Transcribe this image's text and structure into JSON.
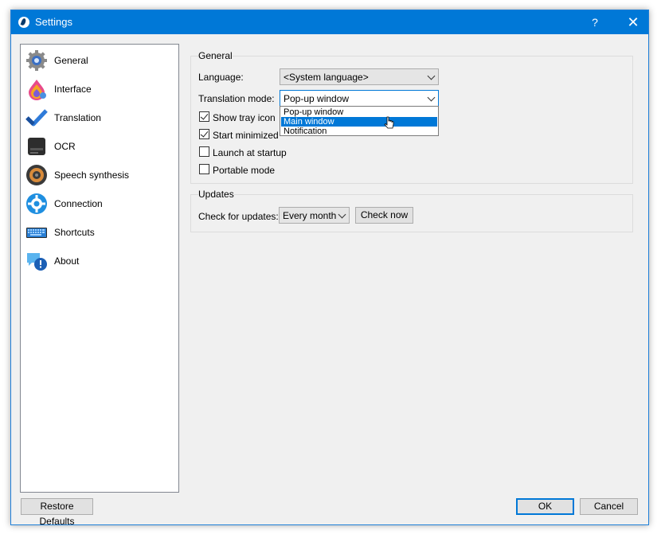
{
  "window": {
    "title": "Settings",
    "help": "?",
    "close": "✕"
  },
  "sidebar": {
    "items": [
      {
        "label": "General",
        "icon": "gear-icon"
      },
      {
        "label": "Interface",
        "icon": "paint-icon"
      },
      {
        "label": "Translation",
        "icon": "checkmark-icon"
      },
      {
        "label": "OCR",
        "icon": "scanner-icon"
      },
      {
        "label": "Speech synthesis",
        "icon": "speaker-icon"
      },
      {
        "label": "Connection",
        "icon": "connection-gear-icon"
      },
      {
        "label": "Shortcuts",
        "icon": "keyboard-icon"
      },
      {
        "label": "About",
        "icon": "info-bubble-icon"
      }
    ]
  },
  "general": {
    "title": "General",
    "language_label": "Language:",
    "language_value": "<System language>",
    "translation_mode_label": "Translation mode:",
    "translation_mode_value": "Pop-up window",
    "translation_mode_options": [
      "Pop-up window",
      "Main window",
      "Notification"
    ],
    "highlighted_option": "Main window",
    "show_tray_icon": {
      "label": "Show tray icon",
      "checked": true
    },
    "start_minimized": {
      "label": "Start minimized",
      "checked": true
    },
    "launch_at_startup": {
      "label": "Launch at startup",
      "checked": false
    },
    "portable_mode": {
      "label": "Portable mode",
      "checked": false
    }
  },
  "updates": {
    "title": "Updates",
    "check_label": "Check for updates:",
    "frequency_value": "Every month",
    "check_now": "Check now"
  },
  "footer": {
    "restore_defaults": "Restore Defaults",
    "ok": "OK",
    "cancel": "Cancel"
  },
  "colors": {
    "titlebar": "#0078d7",
    "selection": "#0078d7"
  }
}
